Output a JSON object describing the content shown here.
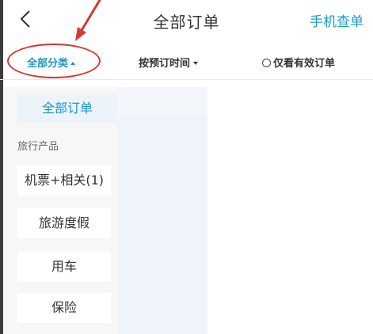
{
  "header": {
    "title": "全部订单",
    "phone_lookup": "手机查单",
    "back_icon": "chevron-left-icon"
  },
  "filters": {
    "category": "全部分类",
    "sort": "按预订时间",
    "valid_only": "仅看有效订单"
  },
  "category_panel": {
    "all_label": "全部订单",
    "group_label": "旅行产品",
    "items": [
      {
        "label": "机票+相关(1)"
      },
      {
        "label": "旅游度假"
      },
      {
        "label": "用车"
      },
      {
        "label": "保险"
      }
    ]
  },
  "colors": {
    "accent": "#1796c4",
    "annotation": "#d23a32",
    "panel_bg": "#f7f7f7"
  }
}
